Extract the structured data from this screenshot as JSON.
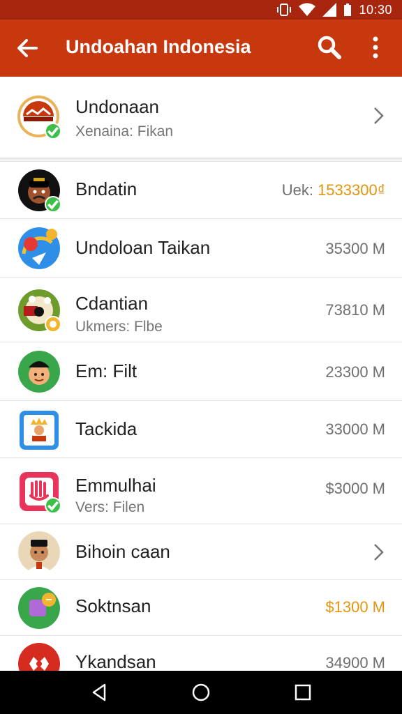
{
  "status_bar": {
    "time": "10:30"
  },
  "app_bar": {
    "title": "Undoahan Indonesia"
  },
  "featured": {
    "title": "Undonaan",
    "subtitle": "Xenaina: Fikan"
  },
  "items": [
    {
      "title": "Bndatin",
      "subtitle": "",
      "value_prefix": "Uek: ",
      "value": "1533300₫"
    },
    {
      "title": "Undoloan Taikan",
      "subtitle": "",
      "value": "35300 M"
    },
    {
      "title": "Cdantian",
      "subtitle": "Ukmers: Flbe",
      "value": "73810 M"
    },
    {
      "title": "Em: Filt",
      "subtitle": "",
      "value": "23300 M"
    },
    {
      "title": "Tackida",
      "subtitle": "",
      "value": "33000 M"
    },
    {
      "title": "Emmulhai",
      "subtitle": "Vers: Filen",
      "value": "$3000 M"
    },
    {
      "title": "Bihoin caan",
      "subtitle": "",
      "value": ""
    },
    {
      "title": "Soktnsan",
      "subtitle": "",
      "value": "$1300 M"
    },
    {
      "title": "Ykandsan",
      "subtitle": "",
      "value": "34900 M"
    }
  ],
  "colors": {
    "primary": "#c8380f",
    "status": "#a8260e",
    "accent_orange": "#e3950f",
    "badge_green": "#3dbf4a"
  },
  "icons": [
    "arrow-back-icon",
    "search-icon",
    "more-vert-icon",
    "chevron-right-icon",
    "check-badge-icon",
    "nav-back-icon",
    "nav-home-icon",
    "nav-recents-icon"
  ]
}
